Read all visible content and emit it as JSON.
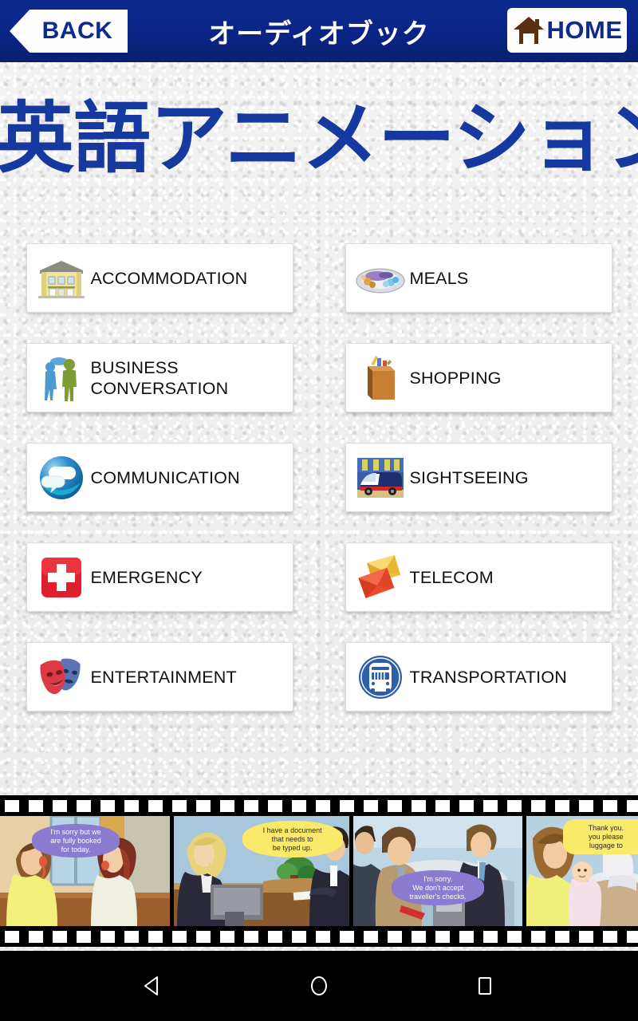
{
  "topbar": {
    "back_label": "BACK",
    "title": "オーディオブック",
    "home_label": "HOME",
    "bar_color": "#0a2486",
    "button_text_color": "#0e2a8a"
  },
  "page": {
    "title": "英語アニメーション",
    "title_color": "#15399e",
    "background_color": "#ececec"
  },
  "menu": {
    "rows": [
      {
        "left": {
          "label": "ACCOMMODATION",
          "icon": "hotel-building-icon"
        },
        "right": {
          "label": "MEALS",
          "icon": "food-plate-icon"
        }
      },
      {
        "left": {
          "label": "BUSINESS\nCONVERSATION",
          "icon": "two-people-talking-icon"
        },
        "right": {
          "label": "SHOPPING",
          "icon": "shopping-bag-icon"
        }
      },
      {
        "left": {
          "label": "COMMUNICATION",
          "icon": "globe-speech-bubbles-icon"
        },
        "right": {
          "label": "SIGHTSEEING",
          "icon": "tour-bus-photo-icon"
        }
      },
      {
        "left": {
          "label": "EMERGENCY",
          "icon": "red-cross-icon"
        },
        "right": {
          "label": "TELECOM",
          "icon": "envelopes-icon"
        }
      },
      {
        "left": {
          "label": "ENTERTAINMENT",
          "icon": "theater-masks-icon"
        },
        "right": {
          "label": "TRANSPORTATION",
          "icon": "bus-circle-icon"
        }
      }
    ]
  },
  "filmstrip": {
    "frames": [
      {
        "name": "hotel-phone-call-scene",
        "bubble": "I'm sorry but we\nare fully booked\nfor today.",
        "bubble_color": "#8a7ad0"
      },
      {
        "name": "office-document-scene",
        "bubble": "I have a document\nthat needs to\nbe typed up.",
        "bubble_color": "#fbe96a",
        "highlight_word": "that"
      },
      {
        "name": "hotel-payment-scene",
        "bubble": "I'm sorry.\nWe don't accept\ntraveller's checks.",
        "bubble_color": "#8a7ad0",
        "highlight_word": "traveller's checks."
      },
      {
        "name": "luggage-request-scene",
        "bubble": "Thank you.\nyou please\nluggage to",
        "bubble_color": "#fbe96a",
        "highlight_word": "luggage to"
      }
    ]
  },
  "navbar": {
    "back": "nav-back-triangle",
    "home": "nav-home-circle",
    "recents": "nav-recents-square"
  }
}
